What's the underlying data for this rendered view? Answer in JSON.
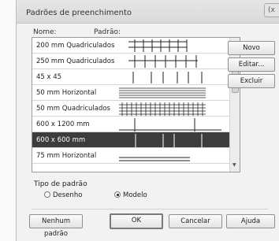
{
  "dialog": {
    "title": "Padrões de preenchimento",
    "close_label": "(x"
  },
  "columns": {
    "name": "Nome:",
    "pattern": "Padrão:"
  },
  "patterns": [
    {
      "name": "200 mm Quadriculados",
      "icon": "grid-pattern"
    },
    {
      "name": "250 mm Quadriculados",
      "icon": "grid-pattern"
    },
    {
      "name": "45 x 45",
      "icon": "vertical-lines-pattern"
    },
    {
      "name": "50 mm Horizontal",
      "icon": "horizontal-lines-pattern"
    },
    {
      "name": "50 mm Quadriculados",
      "icon": "dense-grid-pattern"
    },
    {
      "name": "600 x 1200 mm",
      "icon": "rectangle-grid-pattern"
    },
    {
      "name": "600 x 600 mm",
      "icon": "square-grid-pattern",
      "selected": true
    },
    {
      "name": "75 mm Horizontal",
      "icon": "horizontal-lines-pattern"
    }
  ],
  "side_buttons": {
    "new": "Novo",
    "edit": "Editar...",
    "delete": "Excluir"
  },
  "pattern_type": {
    "label": "Tipo de padrão",
    "drafting": "Desenho",
    "model": "Modelo",
    "selected": "Modelo"
  },
  "footer": {
    "no_pattern": "Nenhum padrão",
    "ok": "OK",
    "cancel": "Cancelar",
    "help": "Ajuda"
  },
  "colors": {
    "selected_row": "#3c3c3c",
    "window_bg": "#f2f2f2"
  }
}
